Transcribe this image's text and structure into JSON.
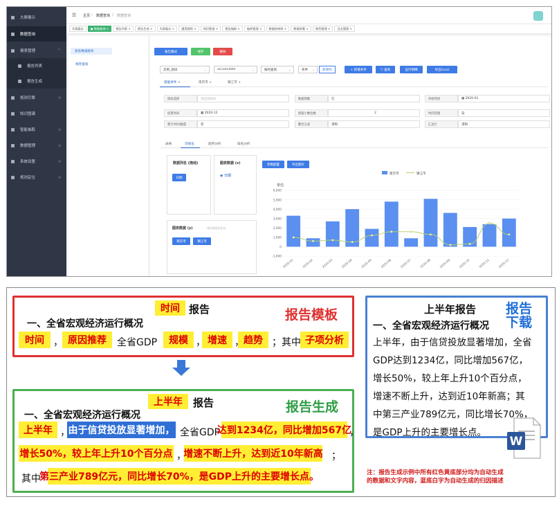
{
  "sidebar": {
    "items": [
      {
        "label": "大屏展示"
      },
      {
        "label": "数据查询"
      },
      {
        "label": "报表管理"
      },
      {
        "label": "报告列表"
      },
      {
        "label": "报告生成"
      },
      {
        "label": "规则引擎"
      },
      {
        "label": "知识图谱"
      },
      {
        "label": "智能抽取"
      },
      {
        "label": "数据管理"
      },
      {
        "label": "系统设置"
      },
      {
        "label": "规则定位"
      }
    ]
  },
  "breadcrumb": {
    "home": "主页",
    "section": "数据查询",
    "current": "数据查询",
    "sep": "/"
  },
  "tabs": [
    {
      "label": "大屏展示"
    },
    {
      "label": "● 数据查询 ×"
    },
    {
      "label": "报告列表 ×"
    },
    {
      "label": "报告生成 ×"
    },
    {
      "label": "大屏展示 ×"
    },
    {
      "label": "通用规则 ×"
    },
    {
      "label": "知识图谱 ×"
    },
    {
      "label": "报告抽取 ×"
    },
    {
      "label": "抽样管理 ×"
    },
    {
      "label": "数据结构树 ×"
    },
    {
      "label": "数据采集 ×"
    },
    {
      "label": "角色管理 ×"
    },
    {
      "label": "日志管理 ×"
    }
  ],
  "left_panel": {
    "query_tab": "查询/数据查询",
    "item": "保存查询"
  },
  "toolbar": {
    "mode": "报告模式",
    "save": "保存",
    "delete": "删除"
  },
  "query_bar": {
    "dataset": "实例_测试",
    "agg": "accumulate",
    "query_type": "按时查询",
    "seq": "条件",
    "add": "新增列",
    "new_cond": "+ 新增条件",
    "search": "查询",
    "run": "运行明细",
    "export": "导出Excel"
  },
  "cond_tabs": [
    {
      "label": "基础条件"
    },
    {
      "label": "南京市"
    },
    {
      "label": "镇江市"
    }
  ],
  "form": [
    {
      "label": "指标选择",
      "value": "请选择指标"
    },
    {
      "label": "数据周数",
      "value": "亿"
    },
    {
      "label": "开始时间",
      "value": "2020-01"
    },
    {
      "label": "结束时间",
      "value": "2020-12"
    },
    {
      "label": "保留小数位数",
      "value": "2"
    },
    {
      "label": "时间范围",
      "value": "日"
    },
    {
      "label": "累计/时间维度",
      "value": "年"
    },
    {
      "label": "聚合方式",
      "value": "求和"
    },
    {
      "label": "汇总行",
      "value": "求和"
    }
  ],
  "view_tabs": [
    {
      "label": "表格"
    },
    {
      "label": "可视化"
    },
    {
      "label": "趋势分析"
    },
    {
      "label": "排名分析"
    }
  ],
  "viz": {
    "col_title": "数据列名 (拖动)",
    "col_btn": "日期",
    "y_title": "图表数据 (x)",
    "radio": "日期",
    "y2_title": "图表数据 (y)",
    "y2_hint": "(拖动数据到此处)",
    "y2_btns": [
      "南京市",
      "镇江市"
    ],
    "cfg": "参数配置",
    "export": "导出图片"
  },
  "chart_data": {
    "type": "bar",
    "ylabel": "单位:",
    "categories": [
      "2020-01",
      "2020-02",
      "2020-03",
      "2020-04",
      "2020-05",
      "2020-06",
      "2020-07",
      "2020-08",
      "2020-09",
      "2020-10",
      "2020-11",
      "2020-12"
    ],
    "ylim": [
      -1000,
      6000
    ],
    "yticks": [
      "6,000",
      "5,000",
      "4,000",
      "3,000",
      "2,000",
      "1,000",
      "0",
      "-1,000"
    ],
    "series": [
      {
        "name": "南京市",
        "type": "bar",
        "color": "#5b8ff0",
        "values": [
          3300,
          900,
          2700,
          4000,
          1900,
          4800,
          900,
          5100,
          3600,
          2100,
          2400,
          3000
        ]
      },
      {
        "name": "镇江市",
        "type": "line",
        "color": "#b5d26a",
        "values": [
          1000,
          600,
          700,
          500,
          1200,
          1600,
          1600,
          1300,
          200,
          300,
          2500,
          1300
        ]
      }
    ]
  },
  "report": {
    "template_label": "报告模板",
    "gen_label": "报告生成",
    "download_label": "报告下载",
    "heading": "一、全省宏观经济运行概况",
    "t_time": "时间",
    "t_report": "报告",
    "t_row": [
      "时间",
      "，",
      "原因推荐",
      "全省GDP",
      "规模",
      "，",
      "增速",
      "，",
      "趋势",
      "；其中",
      "子项分析"
    ],
    "g_time": "上半年",
    "g_report": "报告",
    "g_row1": [
      "上半年",
      "，",
      "由于信贷投放显著增加，",
      "全省GDP",
      "达到1234亿，同比增加567亿",
      "，"
    ],
    "g_row2": [
      "增长50%，较上年上升10个百分点",
      "，",
      "增速不断上升，达到近10年新高",
      "；"
    ],
    "g_row3": [
      "其中",
      "第三产业789亿元，同比增长70%，是GDP上升的主要增长点。"
    ],
    "dl_title": "上半年报告",
    "dl_heading": "一、全省宏观经济运行概况",
    "dl_lines": [
      "上半年，由于信贷投放显著增加，全省",
      "GDP达到1234亿，同比增加567亿，",
      "增长50%，较上年上升10个百分点，",
      "增速不断上升，达到近10年新高；其",
      "中第三产业789亿元，同比增长70%，",
      "是GDP上升的主要增长点。"
    ],
    "note": [
      "注：报告生成示例中所有红色黄底部分均为自动生成",
      "的数据和文字内容，蓝底白字为自动生成的归因描述"
    ]
  },
  "colors": {
    "red": "#e03030",
    "green": "#2f9e44",
    "blue": "#1f6fd8",
    "yellow": "#ffee33",
    "word": "#2b579a"
  }
}
